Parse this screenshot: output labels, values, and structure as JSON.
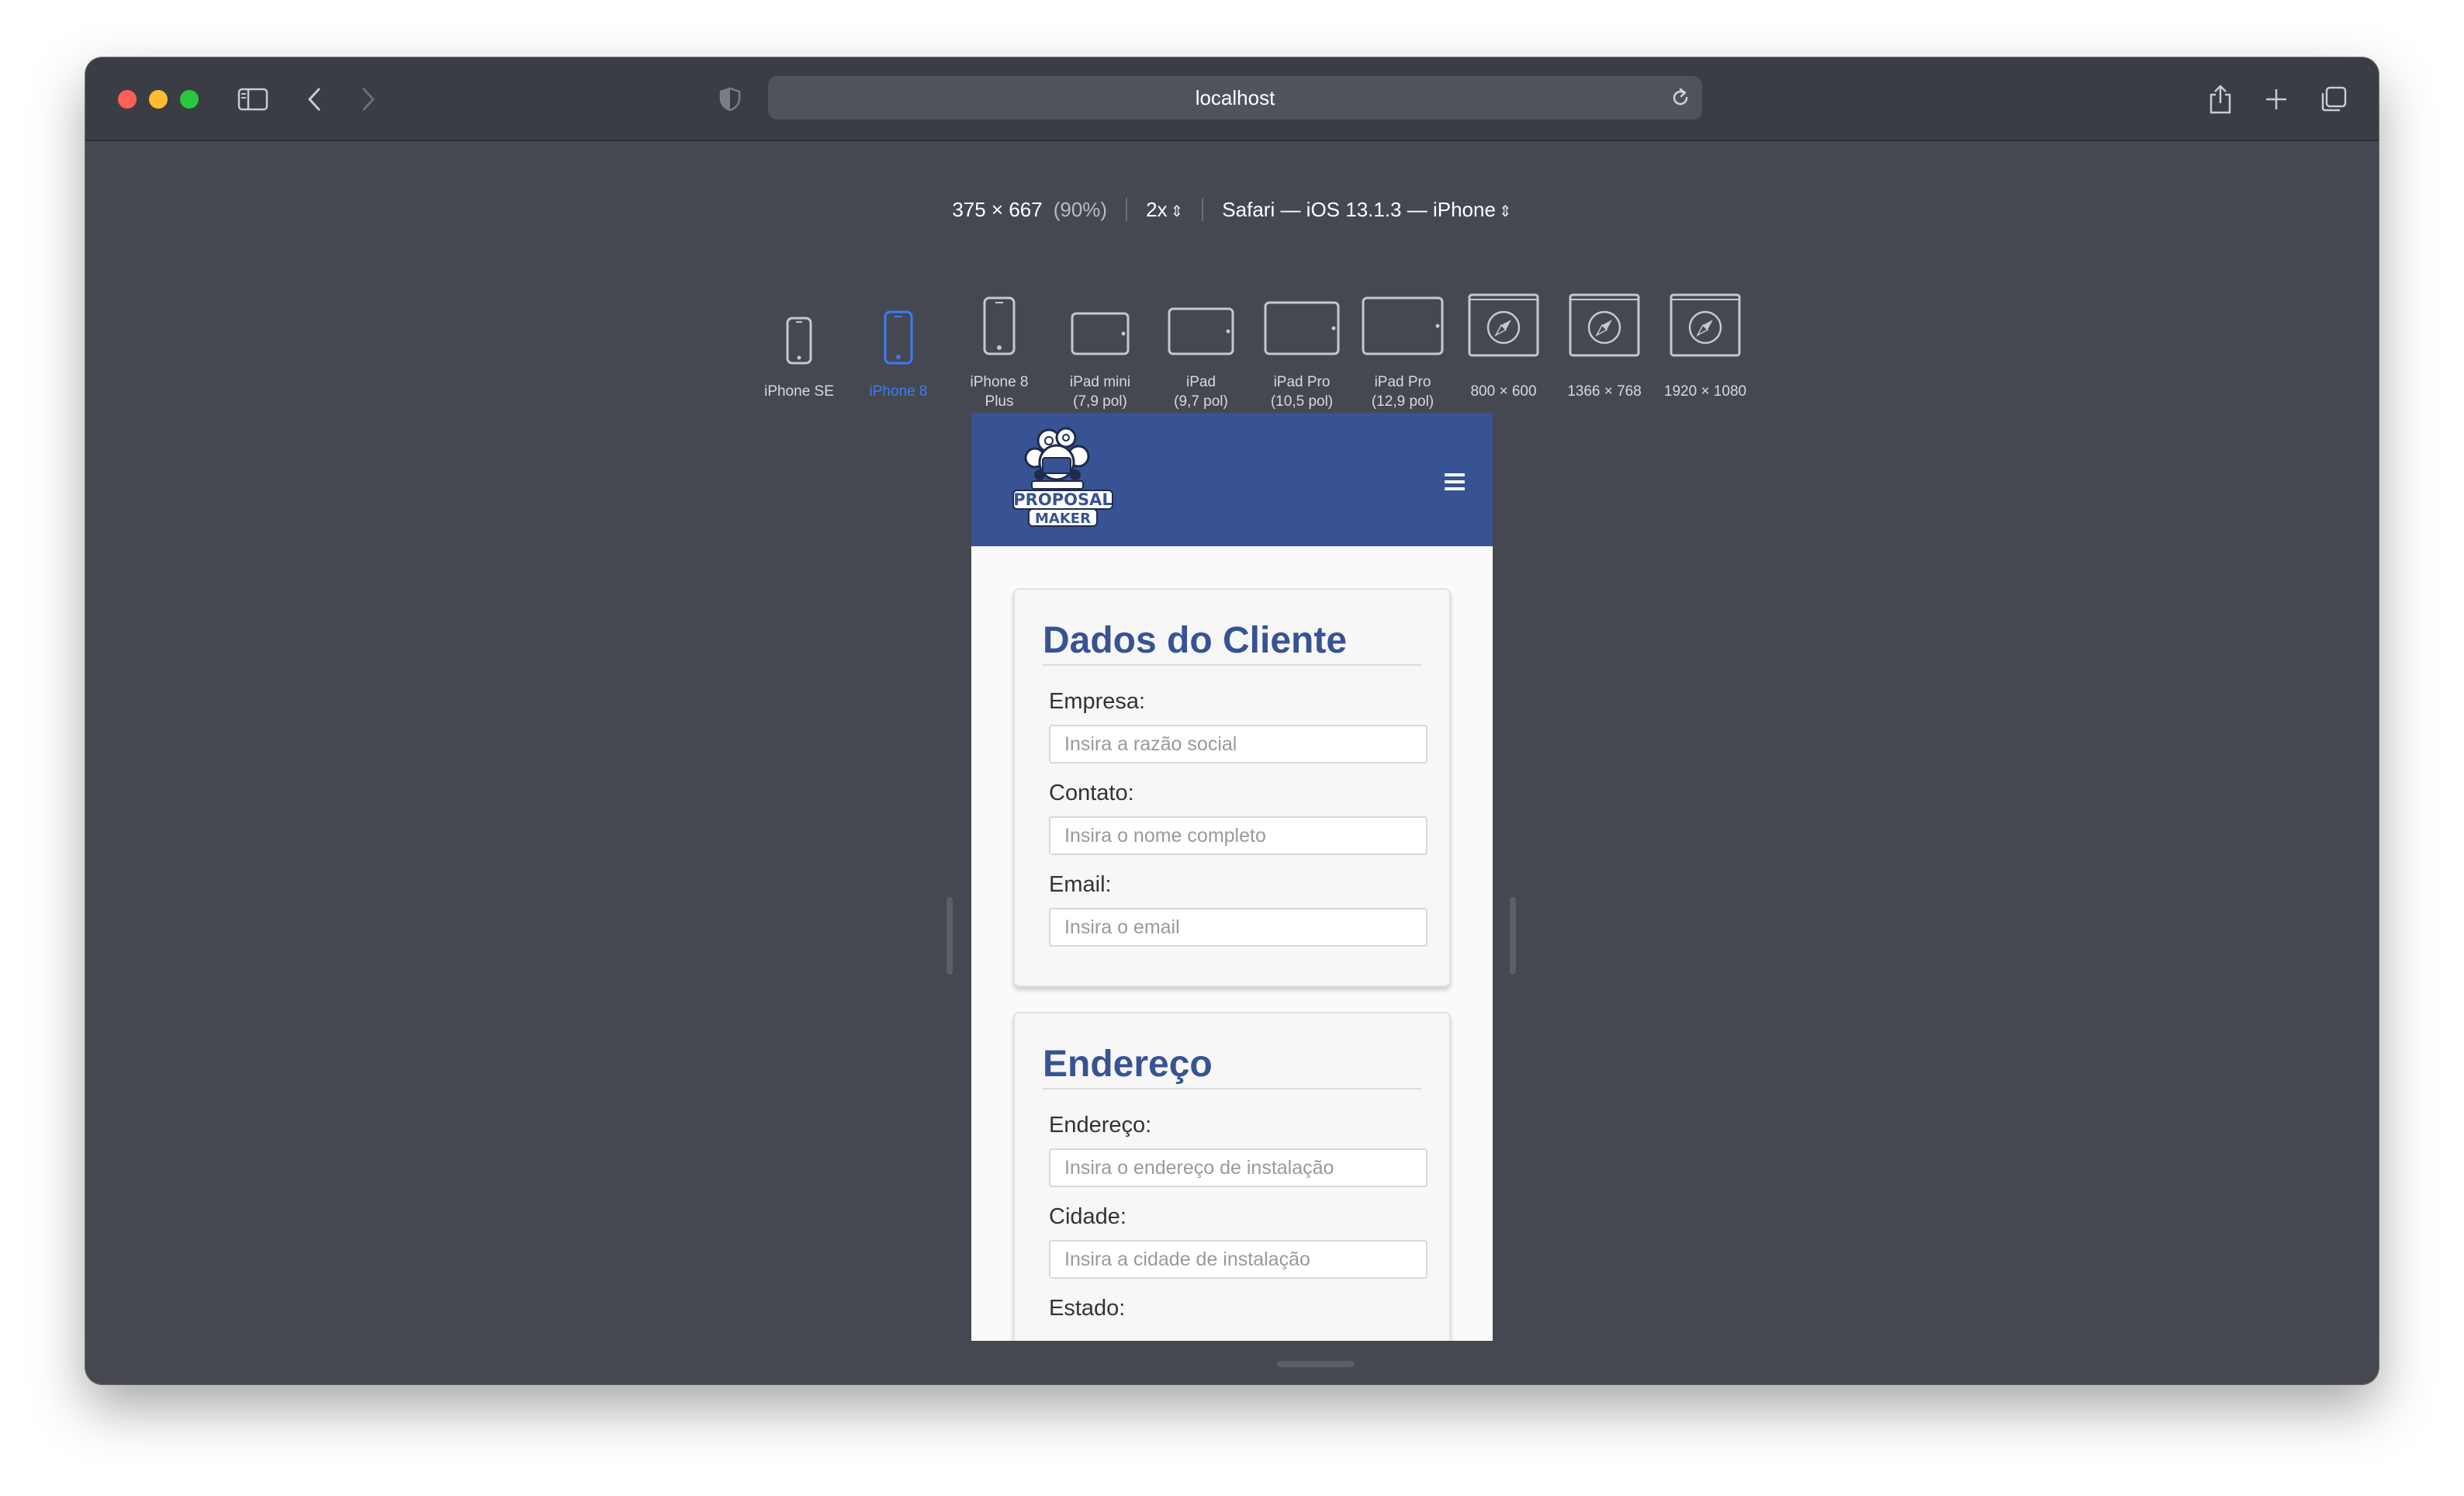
{
  "browser": {
    "url": "localhost"
  },
  "responsive": {
    "dimensions": "375 × 667",
    "zoom": "(90%)",
    "scale": "2x",
    "agent": "Safari — iOS 13.1.3 — iPhone",
    "updown_glyph": "⇕",
    "devices": [
      {
        "label": "iPhone SE",
        "icon": "phone-small-icon",
        "active": false
      },
      {
        "label": "iPhone 8",
        "icon": "phone-icon",
        "active": true
      },
      {
        "label": "iPhone 8\nPlus",
        "icon": "phone-large-icon",
        "active": false
      },
      {
        "label": "iPad mini\n(7,9 pol)",
        "icon": "tablet-icon",
        "active": false
      },
      {
        "label": "iPad\n(9,7 pol)",
        "icon": "tablet-icon",
        "active": false
      },
      {
        "label": "iPad Pro\n(10,5 pol)",
        "icon": "tablet-icon",
        "active": false
      },
      {
        "label": "iPad Pro\n(12,9 pol)",
        "icon": "tablet-icon",
        "active": false
      },
      {
        "label": "800 × 600",
        "icon": "safari-compass-icon",
        "active": false
      },
      {
        "label": "1366 × 768",
        "icon": "safari-compass-icon",
        "active": false
      },
      {
        "label": "1920 × 1080",
        "icon": "safari-compass-icon",
        "active": false
      }
    ]
  },
  "app": {
    "logo_line1": "PROPOSAL",
    "logo_line2": "MAKER",
    "cliente": {
      "title": "Dados do Cliente",
      "fields": [
        {
          "label": "Empresa:",
          "placeholder": "Insira a razão social"
        },
        {
          "label": "Contato:",
          "placeholder": "Insira o nome completo"
        },
        {
          "label": "Email:",
          "placeholder": "Insira o email"
        }
      ]
    },
    "endereco": {
      "title": "Endereço",
      "fields": [
        {
          "label": "Endereço:",
          "placeholder": "Insira o endereço de instalação"
        },
        {
          "label": "Cidade:",
          "placeholder": "Insira a cidade de instalação"
        },
        {
          "label": "Estado:",
          "placeholder": ""
        }
      ]
    }
  },
  "colors": {
    "brand": "#375394",
    "active_device": "#3d7bf5",
    "window_bg": "#454850"
  }
}
